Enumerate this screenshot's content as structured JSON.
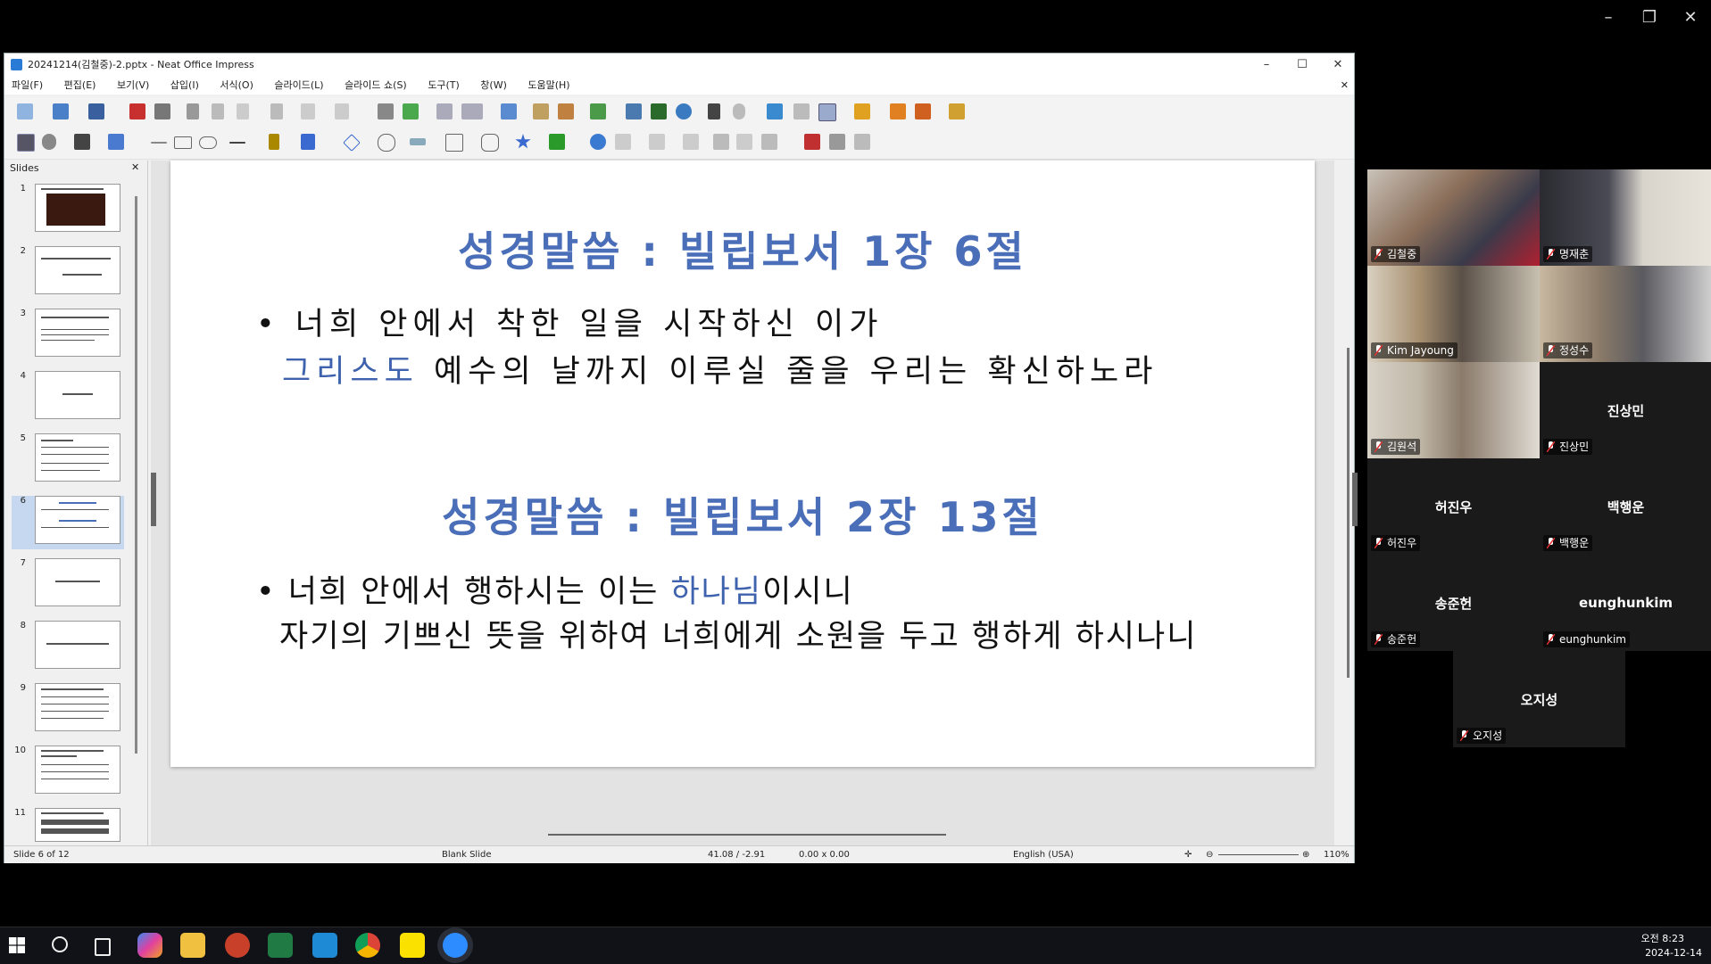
{
  "window": {
    "title": "20241214(김철중)-2.pptx - Neat Office Impress",
    "minimize": "–",
    "maximize": "☐",
    "close": "✕",
    "doc_close": "✕"
  },
  "screen_controls": {
    "minimize": "–",
    "restore": "❐",
    "close": "✕"
  },
  "menu": [
    "파일(F)",
    "편집(E)",
    "보기(V)",
    "삽입(I)",
    "서식(O)",
    "슬라이드(L)",
    "슬라이드 쇼(S)",
    "도구(T)",
    "창(W)",
    "도움말(H)"
  ],
  "slides_panel": {
    "title": "Slides",
    "close": "✕",
    "numbers": [
      "1",
      "2",
      "3",
      "4",
      "5",
      "6",
      "7",
      "8",
      "9",
      "10",
      "11"
    ],
    "selected": "6"
  },
  "slide": {
    "heading1": "성경말씀 : 빌립보서 1장 6절",
    "bullet1_line1": "• 너희 안에서 착한 일을 시작하신 이가",
    "bullet1_line2_hl": "그리스도",
    "bullet1_line2_rest": " 예수의 날까지 이루실 줄을 우리는 확신하노라",
    "heading2": "성경말씀 : 빌립보서 2장 13절",
    "bullet2_line1_pre": "• 너희 안에서 행하시는 이는 ",
    "bullet2_line1_hl": "하나님",
    "bullet2_line1_post": "이시니",
    "bullet2_line2": "자기의 기쁘신 뜻을 위하여 너희에게 소원을 두고 행하게 하시나니"
  },
  "status": {
    "slide": "Slide 6 of 12",
    "layout": "Blank Slide",
    "position": "41.08 / -2.91",
    "size": "0.00 x 0.00",
    "language": "English (USA)",
    "zoom": "110%"
  },
  "participants": [
    {
      "name": "김철중",
      "video": true,
      "active": true
    },
    {
      "name": "명재춘",
      "video": true
    },
    {
      "name": "Kim Jayoung",
      "video": true
    },
    {
      "name": "정성수",
      "video": true
    },
    {
      "name": "김원석",
      "video": true
    },
    {
      "name": "진상민",
      "video": false
    },
    {
      "name": "허진우",
      "video": false
    },
    {
      "name": "백행운",
      "video": false
    },
    {
      "name": "송준헌",
      "video": false
    },
    {
      "name": "eunghunkim",
      "video": false
    },
    {
      "name": "오지성",
      "video": false
    }
  ],
  "clock": {
    "time": "오전 8:23",
    "date": "2024-12-14"
  },
  "colors": {
    "accent": "#4a6eb8",
    "active_speaker": "#2ecc71",
    "muted": "#e03030"
  }
}
